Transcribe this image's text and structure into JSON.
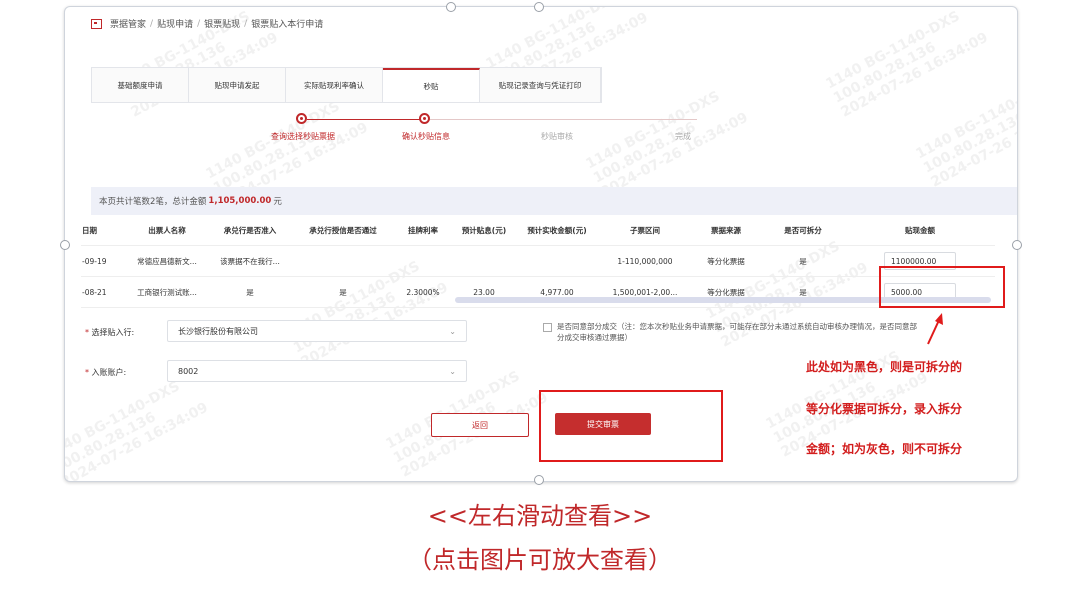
{
  "breadcrumb": [
    "票据管家",
    "贴现申请",
    "银票贴现",
    "银票贴入本行申请"
  ],
  "tabs": [
    "基础额度申请",
    "贴现申请发起",
    "实际贴现利率确认",
    "秒贴",
    "贴现记录查询与凭证打印"
  ],
  "active_tab": "秒贴",
  "steps": [
    {
      "label": "查询选择秒贴票据",
      "done": true
    },
    {
      "label": "确认秒贴信息",
      "done": true
    },
    {
      "label": "秒贴审核",
      "done": false
    },
    {
      "label": "完成",
      "done": false
    }
  ],
  "summary": {
    "prefix": "本页共计笔数2笔，总计金额",
    "amount": "1,105,000.00",
    "suffix": "元"
  },
  "table": {
    "headers": [
      "日期",
      "出票人名称",
      "承兑行是否准入",
      "承兑行授信是否通过",
      "挂牌利率",
      "预计贴息(元)",
      "预计实收金额(元)",
      "子票区间",
      "票据来源",
      "是否可拆分",
      "贴现金额"
    ],
    "rows": [
      [
        "-09-19",
        "常德应昌德新文...",
        "该票据不在我行...",
        "",
        "",
        "",
        "",
        "1-110,000,000",
        "等分化票据",
        "是",
        "1100000.00"
      ],
      [
        "-08-21",
        "工商银行测试账...",
        "是",
        "是",
        "2.3000%",
        "23.00",
        "4,977.00",
        "1,500,001-2,00...",
        "等分化票据",
        "是",
        "5000.00"
      ]
    ]
  },
  "form": {
    "bank_label": "选择贴入行:",
    "bank_value": "长沙银行股份有限公司",
    "account_label": "入账账户:",
    "account_value": "8002",
    "required_mark": "*",
    "partial_text": "是否同意部分成交（注：您本次秒贴业务申请票据，可能存在部分未通过系统自动审核办理情况，是否同意部分成交审核通过票据）"
  },
  "buttons": {
    "back": "返回",
    "submit": "提交审票"
  },
  "annotation": [
    "此处如为黑色，则是可拆分的",
    "等分化票据可拆分，录入拆分",
    "金额；如为灰色，则不可拆分"
  ],
  "captions": [
    "<<左右滑动查看>>",
    "（点击图片可放大查看）"
  ],
  "watermark": "1140 BG-1140-DXS\n100.80.28.136\n2024-07-26 16:34:09",
  "colors": {
    "accent": "#c0282a",
    "highlight": "#e01b1b"
  }
}
